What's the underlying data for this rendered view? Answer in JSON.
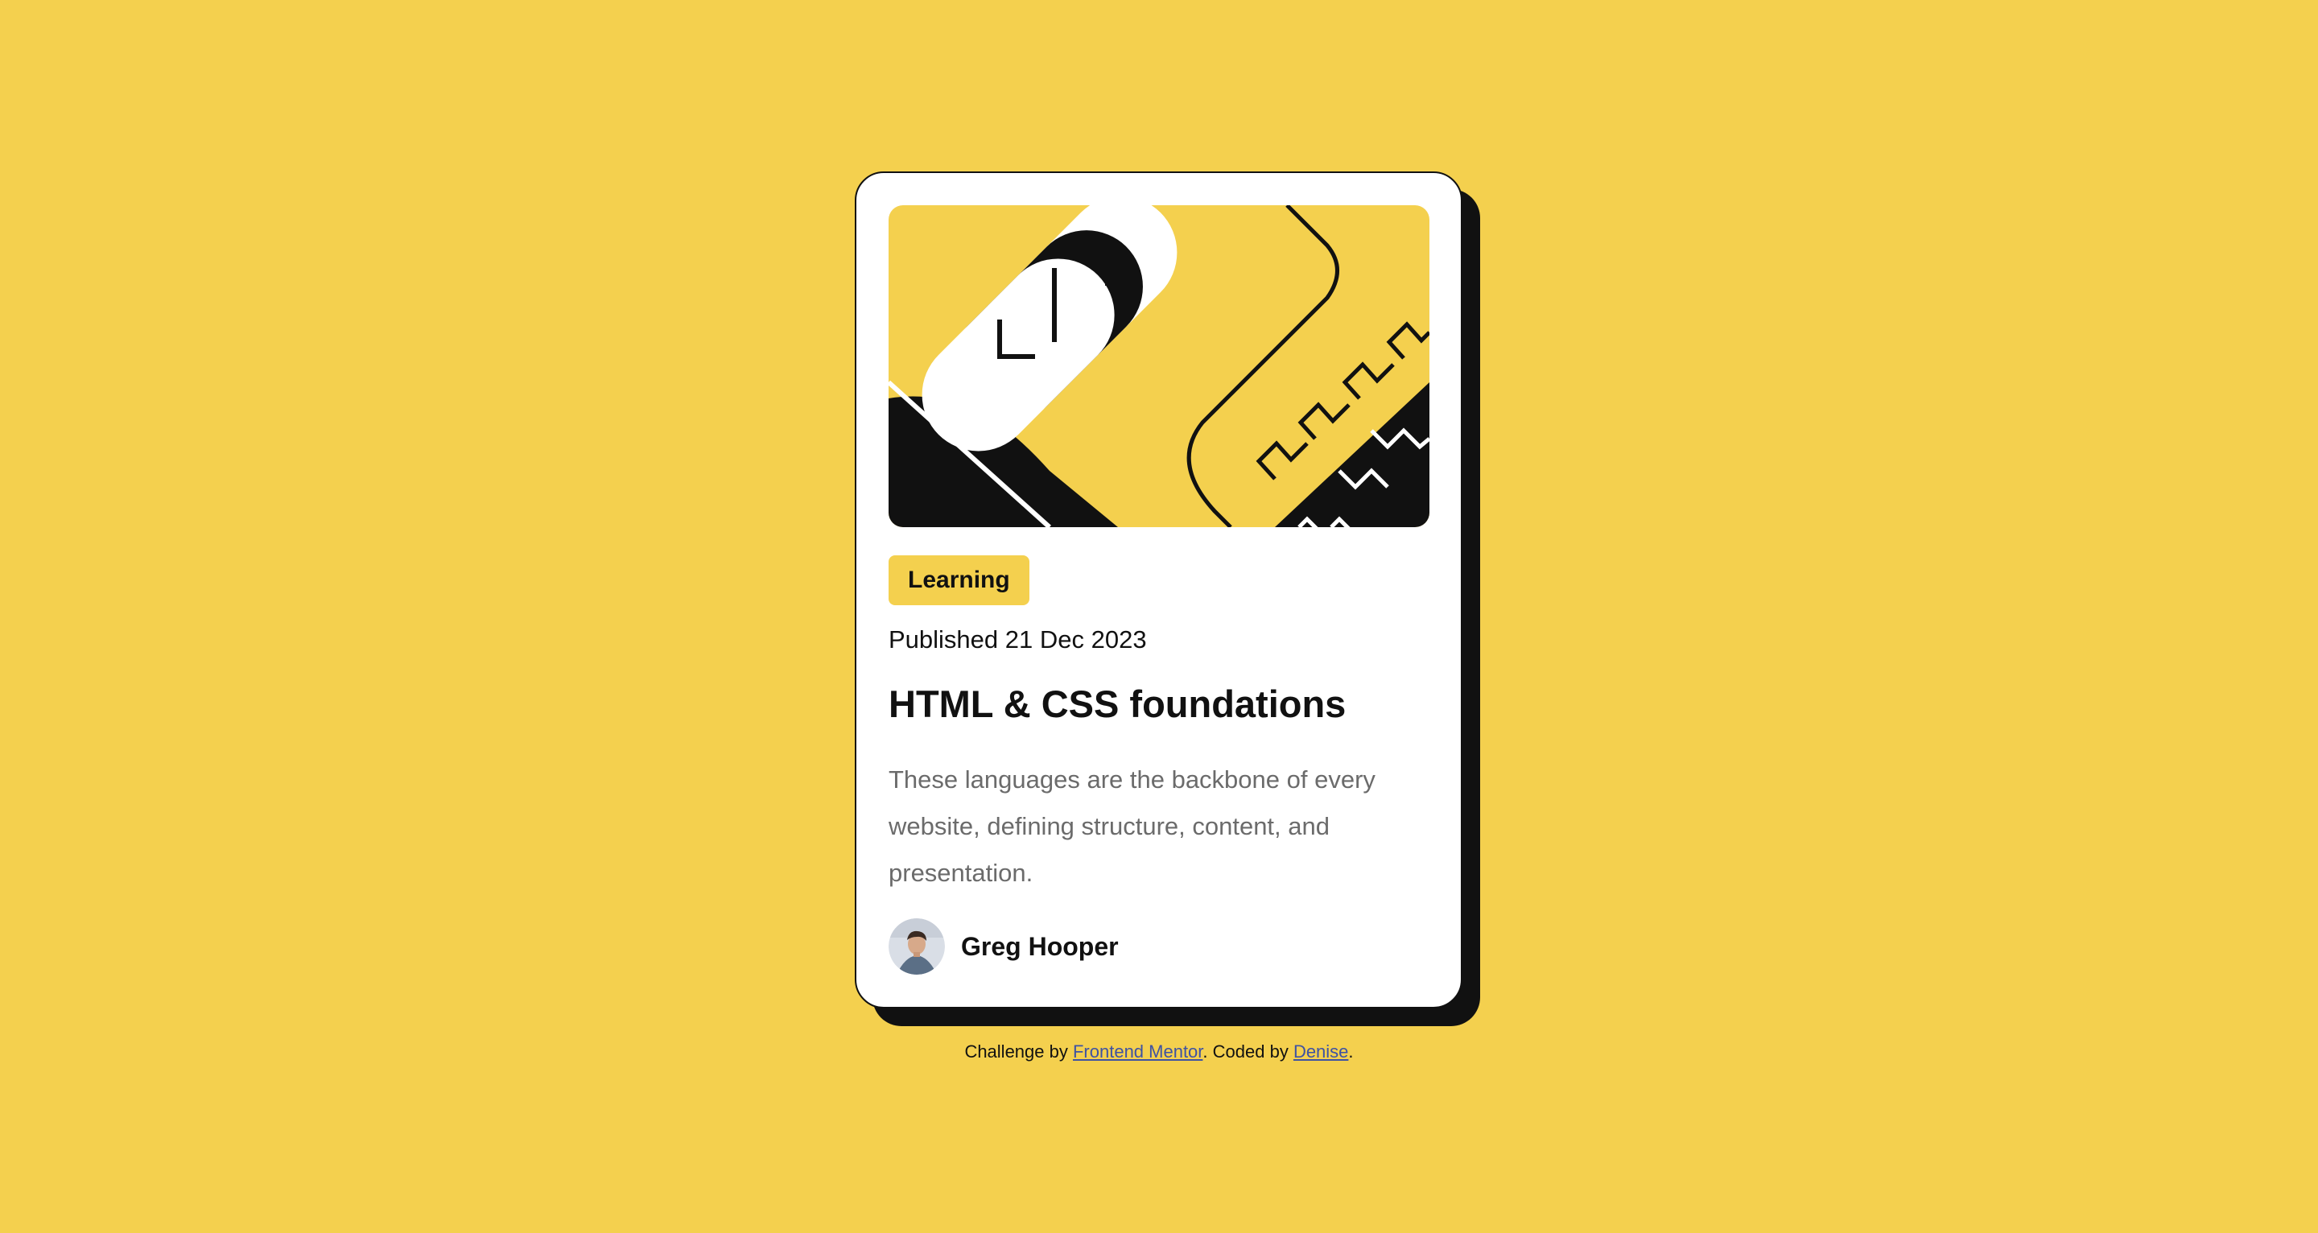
{
  "card": {
    "category": "Learning",
    "published": "Published 21 Dec 2023",
    "title": "HTML & CSS foundations",
    "description": "These languages are the backbone of every website, defining structure, content, and presentation.",
    "author": "Greg Hooper"
  },
  "footer": {
    "prefix": "Challenge by ",
    "challenge_link": "Frontend Mentor",
    "middle": ". Coded by ",
    "coder_link": "Denise",
    "suffix": "."
  },
  "colors": {
    "background": "#F4D04E",
    "card": "#FFFFFF",
    "ink": "#111111",
    "muted": "#6B6B6B",
    "link": "#3E52A3"
  },
  "icons": {
    "hero": "abstract-geometric-illustration",
    "avatar": "author-portrait"
  }
}
